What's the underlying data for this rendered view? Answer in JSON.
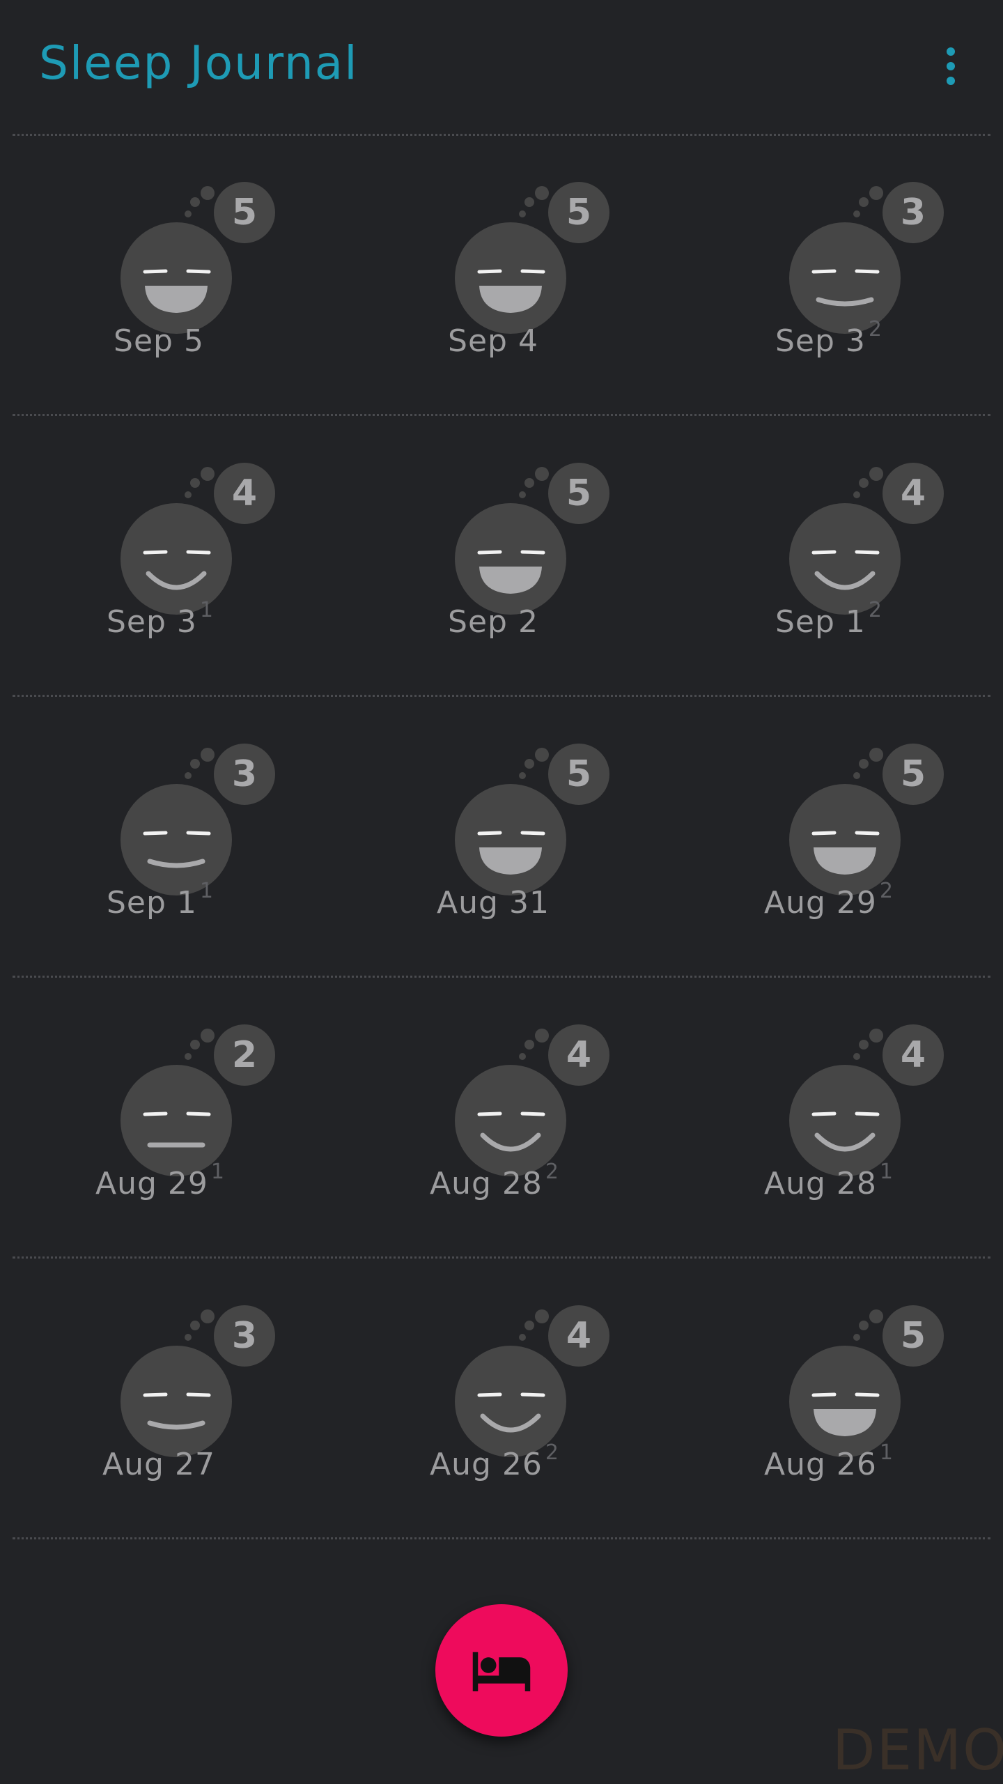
{
  "app": {
    "title": "Sleep Journal",
    "menu_icon": "more-vert-icon",
    "accent_color": "#1e9bb5"
  },
  "entries": [
    {
      "date": "Sep 5",
      "index": "",
      "rating": "5",
      "mood": "laugh"
    },
    {
      "date": "Sep 4",
      "index": "",
      "rating": "5",
      "mood": "laugh"
    },
    {
      "date": "Sep 3",
      "index": "2",
      "rating": "3",
      "mood": "content"
    },
    {
      "date": "Sep 3",
      "index": "1",
      "rating": "4",
      "mood": "smile"
    },
    {
      "date": "Sep 2",
      "index": "",
      "rating": "5",
      "mood": "laugh"
    },
    {
      "date": "Sep 1",
      "index": "2",
      "rating": "4",
      "mood": "smile"
    },
    {
      "date": "Sep 1",
      "index": "1",
      "rating": "3",
      "mood": "content"
    },
    {
      "date": "Aug 31",
      "index": "",
      "rating": "5",
      "mood": "laugh"
    },
    {
      "date": "Aug 29",
      "index": "2",
      "rating": "5",
      "mood": "laugh"
    },
    {
      "date": "Aug 29",
      "index": "1",
      "rating": "2",
      "mood": "neutral"
    },
    {
      "date": "Aug 28",
      "index": "2",
      "rating": "4",
      "mood": "smile"
    },
    {
      "date": "Aug 28",
      "index": "1",
      "rating": "4",
      "mood": "smile"
    },
    {
      "date": "Aug 27",
      "index": "",
      "rating": "3",
      "mood": "content"
    },
    {
      "date": "Aug 26",
      "index": "2",
      "rating": "4",
      "mood": "smile"
    },
    {
      "date": "Aug 26",
      "index": "1",
      "rating": "5",
      "mood": "laugh"
    }
  ],
  "fab": {
    "icon": "bed-icon",
    "color": "#ee0b5c"
  },
  "watermark": "DEMO"
}
